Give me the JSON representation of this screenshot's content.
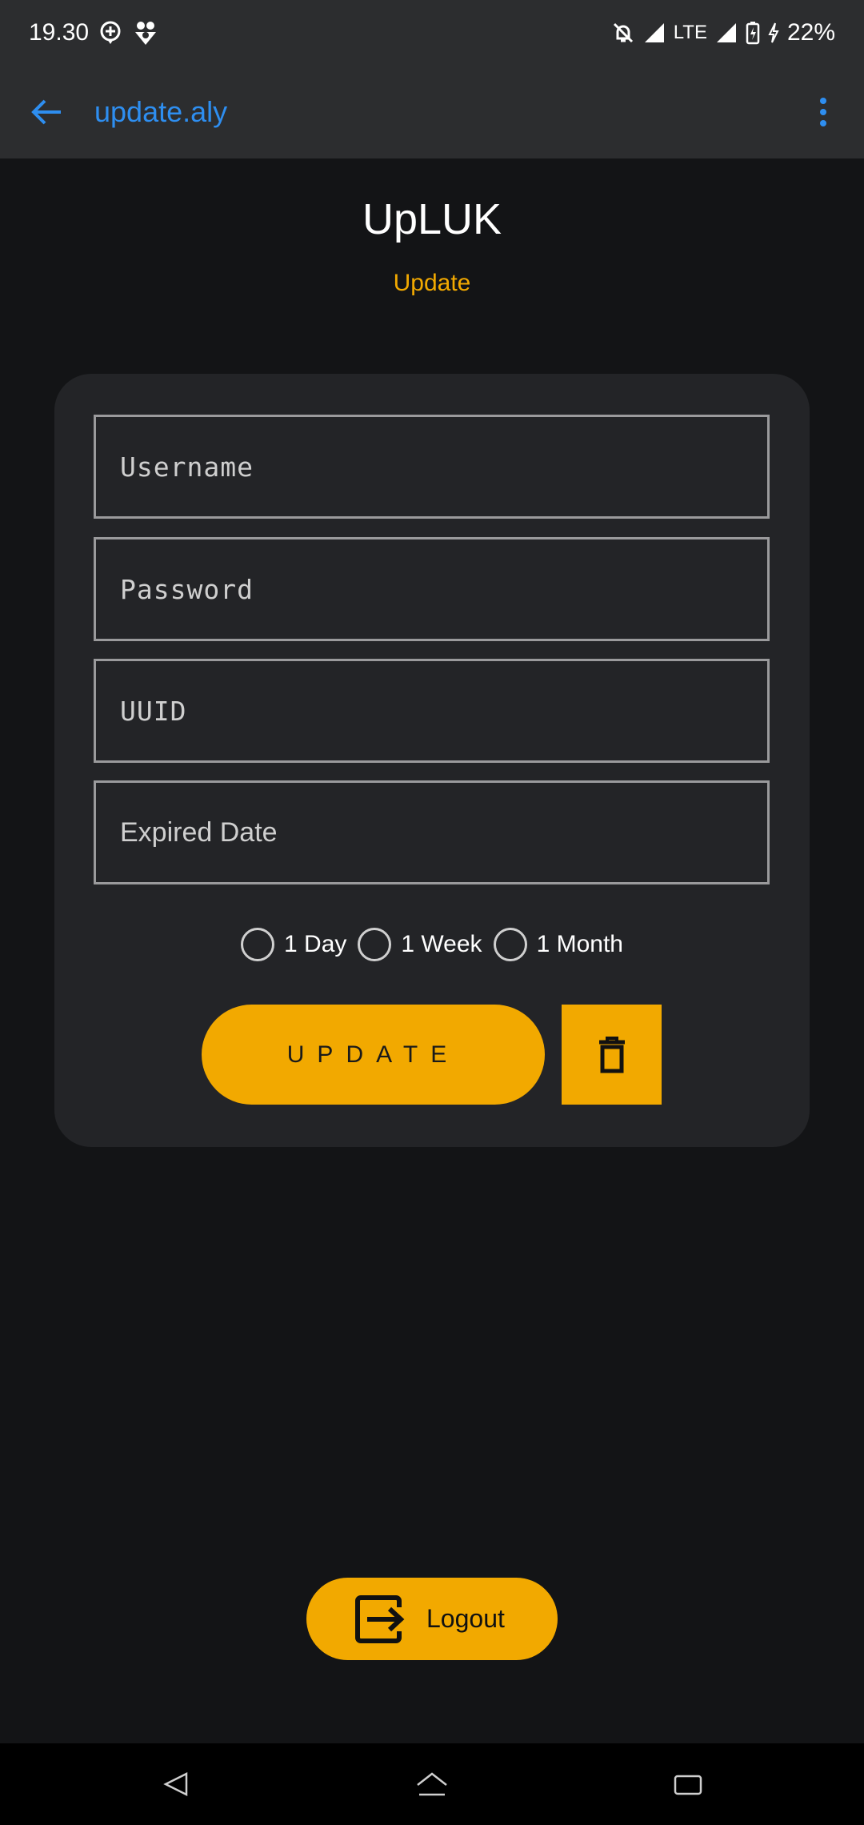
{
  "status_bar": {
    "time": "19.30",
    "network": "LTE",
    "battery": "22%"
  },
  "app_bar": {
    "title": "update.aly"
  },
  "header": {
    "title": "UpLUK",
    "subtitle": "Update"
  },
  "form": {
    "username_placeholder": "Username",
    "password_placeholder": "Password",
    "uuid_placeholder": "UUID",
    "expired_placeholder": "Expired Date",
    "durations": [
      {
        "label": "1 Day"
      },
      {
        "label": "1 Week"
      },
      {
        "label": "1 Month"
      }
    ],
    "update_label": "UPDATE"
  },
  "logout": {
    "label": "Logout"
  },
  "colors": {
    "accent": "#f2a900",
    "link": "#2e8ef0",
    "background": "#131416",
    "card": "#232427",
    "bar": "#2c2d2f"
  },
  "icons": {
    "back": "arrow-back-icon",
    "menu": "more-vert-icon",
    "delete": "trash-icon",
    "logout": "exit-icon"
  }
}
